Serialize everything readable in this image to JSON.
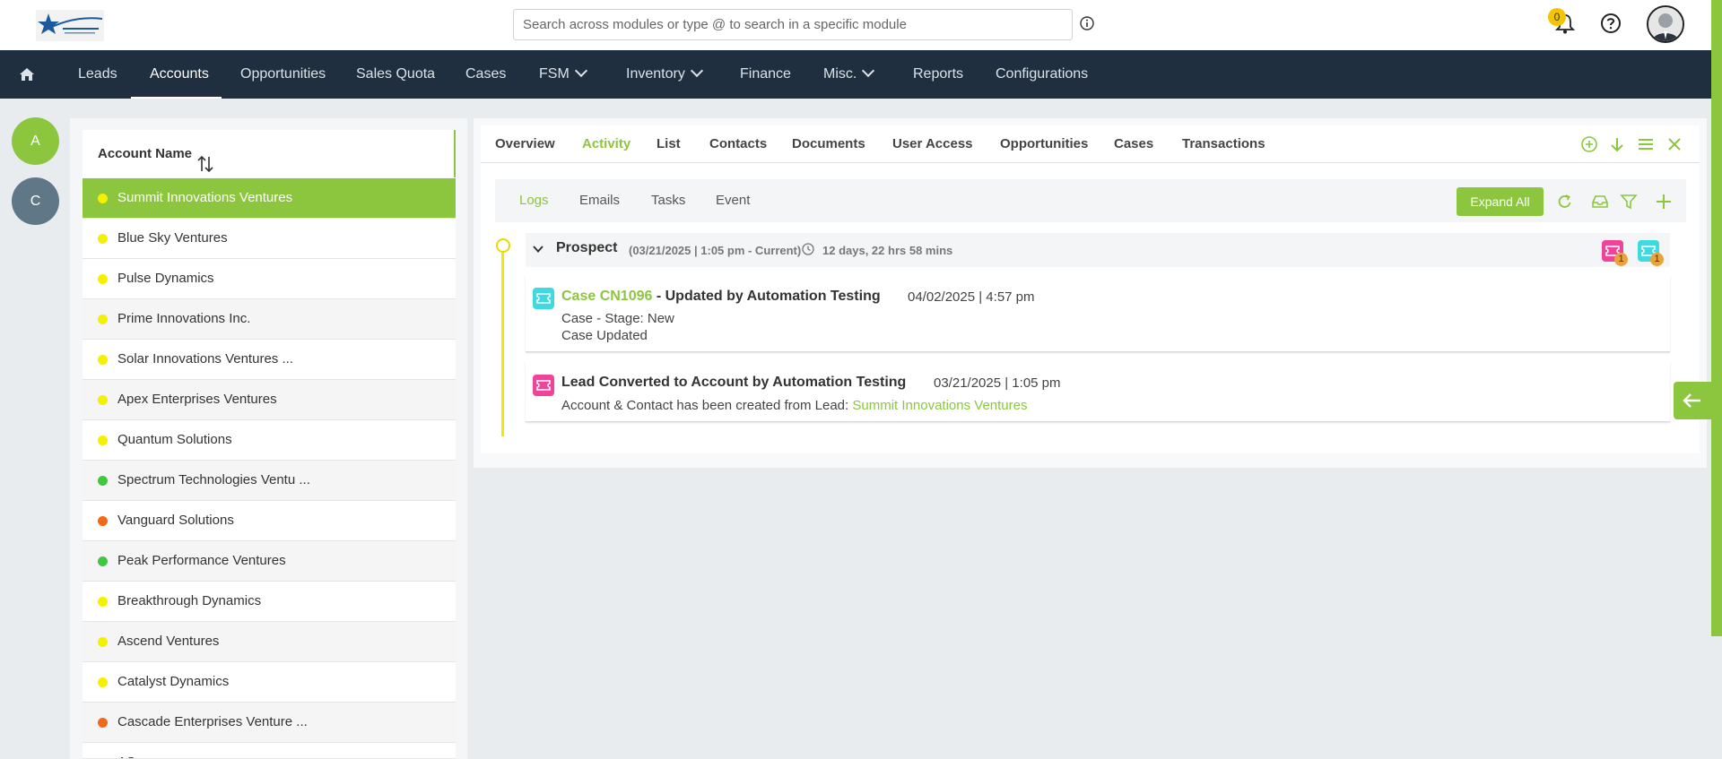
{
  "header": {
    "search_placeholder": "Search across modules or type @ to search in a specific module",
    "notifications_count": "0"
  },
  "nav": {
    "items": [
      {
        "label": "Leads"
      },
      {
        "label": "Accounts",
        "active": true
      },
      {
        "label": "Opportunities"
      },
      {
        "label": "Sales Quota"
      },
      {
        "label": "Cases"
      },
      {
        "label": "FSM",
        "dropdown": true
      },
      {
        "label": "Inventory",
        "dropdown": true
      },
      {
        "label": "Finance"
      },
      {
        "label": "Misc.",
        "dropdown": true
      },
      {
        "label": "Reports"
      },
      {
        "label": "Configurations"
      }
    ]
  },
  "letters": [
    "A",
    "C"
  ],
  "accounts": {
    "header_label": "Account Name",
    "rows": [
      {
        "name": "Summit Innovations Ventures",
        "status_color": "#f4f000",
        "selected": true
      },
      {
        "name": "Blue Sky Ventures",
        "status_color": "#f4f000"
      },
      {
        "name": "Pulse Dynamics",
        "status_color": "#f4f000"
      },
      {
        "name": "Prime Innovations Inc.",
        "status_color": "#f4f000"
      },
      {
        "name": "Solar Innovations Ventures ...",
        "status_color": "#f4f000"
      },
      {
        "name": "Apex Enterprises Ventures",
        "status_color": "#f4f000"
      },
      {
        "name": "Quantum Solutions",
        "status_color": "#f4f000"
      },
      {
        "name": "Spectrum Technologies Ventu ...",
        "status_color": "#3cc93c"
      },
      {
        "name": "Vanguard Solutions",
        "status_color": "#f06a1a"
      },
      {
        "name": "Peak Performance Ventures",
        "status_color": "#3cc93c"
      },
      {
        "name": "Breakthrough Dynamics",
        "status_color": "#f4f000"
      },
      {
        "name": "Ascend Ventures",
        "status_color": "#f4f000"
      },
      {
        "name": "Catalyst Dynamics",
        "status_color": "#f4f000"
      },
      {
        "name": "Cascade Enterprises Venture ...",
        "status_color": "#f06a1a"
      },
      {
        "name": "AS",
        "status_color": "#f4f000"
      }
    ]
  },
  "detail": {
    "tabs": [
      {
        "label": "Overview"
      },
      {
        "label": "Activity",
        "active": true
      },
      {
        "label": "List"
      },
      {
        "label": "Contacts"
      },
      {
        "label": "Documents"
      },
      {
        "label": "User Access"
      },
      {
        "label": "Opportunities"
      },
      {
        "label": "Cases"
      },
      {
        "label": "Transactions"
      }
    ],
    "subtabs": [
      {
        "label": "Logs",
        "active": true
      },
      {
        "label": "Emails"
      },
      {
        "label": "Tasks"
      },
      {
        "label": "Event"
      }
    ],
    "expand_all_label": "Expand All",
    "stage": {
      "title": "Prospect",
      "range": "(03/21/2025 | 1:05 pm - Current)",
      "duration": "12 days, 22 hrs 58 mins",
      "badges": [
        {
          "icon": "ticket-icon",
          "color": "#f0449b",
          "count": "1"
        },
        {
          "icon": "ticket-icon",
          "color": "#3fd9e0",
          "count": "1"
        }
      ]
    },
    "logs": [
      {
        "icon_color": "#3fd9e0",
        "link": "Case CN1096",
        "title": " - Updated by Automation Testing",
        "date": "04/02/2025 | 4:57 pm",
        "line1": "Case - Stage: New",
        "line2": "Case Updated"
      },
      {
        "icon_color": "#f0449b",
        "title": "Lead Converted to Account by Automation Testing",
        "date": "03/21/2025 | 1:05 pm",
        "line1_prefix": "Account & Contact has been created from Lead: ",
        "line1_link": "Summit Innovations Ventures"
      }
    ]
  },
  "colors": {
    "accent": "#8cc63f",
    "nav_bg": "#1f2f3f"
  }
}
